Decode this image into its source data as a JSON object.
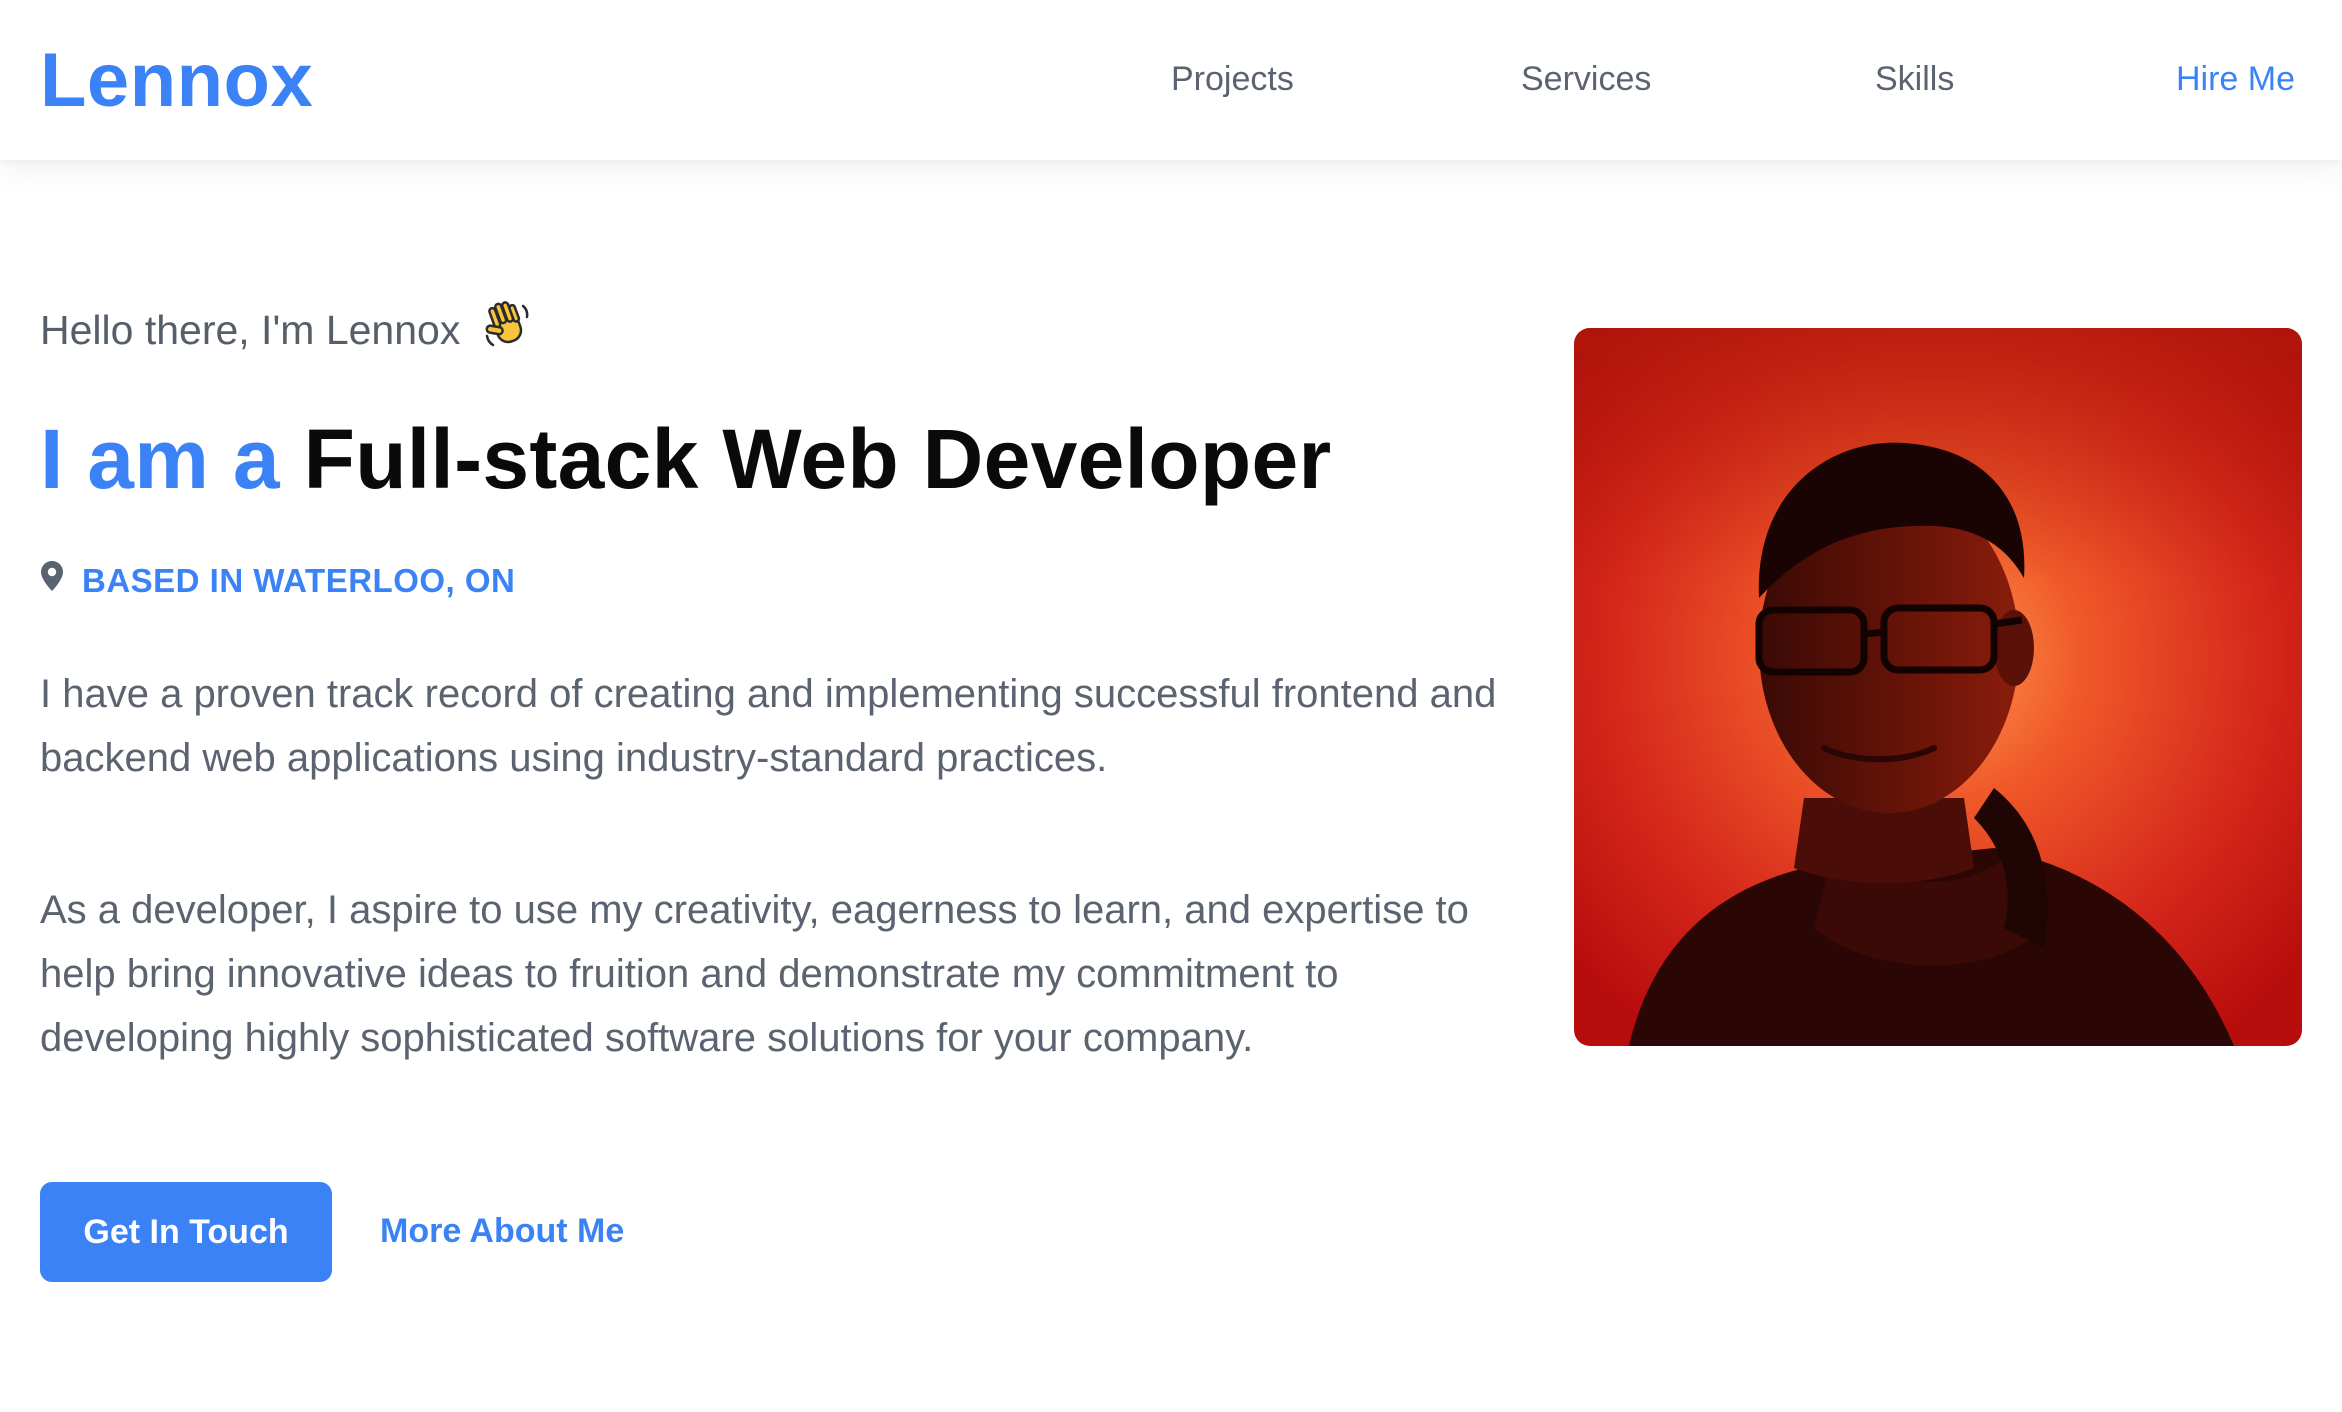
{
  "brand": {
    "name": "Lennox",
    "color": "#3b82f6"
  },
  "nav": {
    "items": [
      {
        "label": "Projects"
      },
      {
        "label": "Services"
      },
      {
        "label": "Skills"
      },
      {
        "label": "Hire Me",
        "highlighted": true
      }
    ]
  },
  "hero": {
    "greeting": "Hello there, I'm Lennox",
    "greeting_emoji": "waving-hand-icon",
    "headline_prefix": "I am a",
    "headline_role": "Full-stack Web Developer",
    "location_icon": "map-pin-icon",
    "location": "BASED IN WATERLOO, ON",
    "paragraphs": [
      "I have a proven track record of creating and implementing successful frontend and backend web applications using industry-standard practices.",
      "As a developer, I aspire to use my creativity, eagerness to learn, and expertise to help bring innovative ideas to fruition and demonstrate my commitment to developing highly sophisticated software solutions for your company."
    ],
    "primary_button": "Get In Touch",
    "secondary_link": "More About Me",
    "portrait": {
      "alt": "Portrait photo",
      "tint": "#d92a12"
    }
  },
  "colors": {
    "accent": "#3b82f6",
    "text_dark": "#0a0a0a",
    "text_muted": "#5b6370",
    "background": "#ffffff"
  }
}
